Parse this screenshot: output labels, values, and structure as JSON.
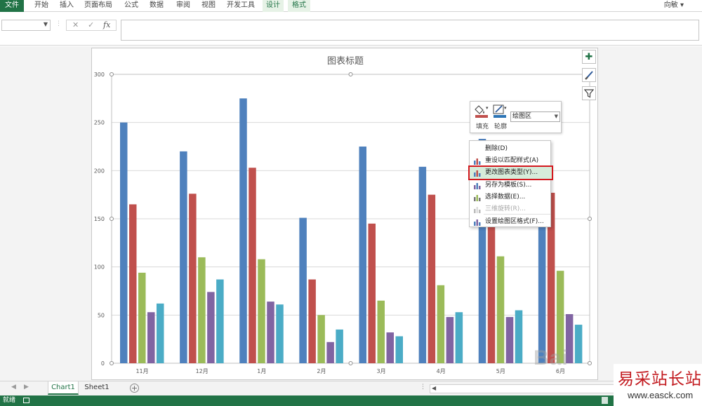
{
  "ribbon": {
    "tabs": [
      {
        "label": "文件",
        "kind": "file"
      },
      {
        "label": "开始",
        "kind": "normal"
      },
      {
        "label": "插入",
        "kind": "normal"
      },
      {
        "label": "页面布局",
        "kind": "normal"
      },
      {
        "label": "公式",
        "kind": "normal"
      },
      {
        "label": "数据",
        "kind": "normal"
      },
      {
        "label": "审阅",
        "kind": "normal"
      },
      {
        "label": "视图",
        "kind": "normal"
      },
      {
        "label": "开发工具",
        "kind": "normal"
      },
      {
        "label": "设计",
        "kind": "context"
      },
      {
        "label": "格式",
        "kind": "context"
      }
    ],
    "user": "向敏 ▾"
  },
  "formula_bar": {
    "name_box": "",
    "cancel_icon": "✕",
    "enter_icon": "✓",
    "fx_label": "fx",
    "formula": ""
  },
  "colors": {
    "excel_green": "#217346",
    "series": [
      "#4f81bd",
      "#c0504d",
      "#9bbb59",
      "#8064a2",
      "#4bacc6"
    ],
    "highlight_box": "#d3181e"
  },
  "chart_data": {
    "type": "bar",
    "title": "图表标题",
    "categories": [
      "11月",
      "12月",
      "1月",
      "2月",
      "3月",
      "4月",
      "5月",
      "6月"
    ],
    "series": [
      {
        "values": [
          250,
          220,
          275,
          151,
          225,
          204,
          233,
          210
        ]
      },
      {
        "values": [
          165,
          176,
          203,
          87,
          145,
          175,
          200,
          177
        ]
      },
      {
        "values": [
          94,
          110,
          108,
          50,
          65,
          81,
          111,
          96
        ]
      },
      {
        "values": [
          53,
          74,
          64,
          22,
          32,
          48,
          48,
          51
        ]
      },
      {
        "values": [
          62,
          87,
          61,
          35,
          28,
          53,
          55,
          40
        ]
      }
    ],
    "yticks": [
      "0",
      "50",
      "100",
      "150",
      "200",
      "250",
      "300"
    ],
    "ylim": [
      0,
      300
    ],
    "grid": true,
    "legend": "none"
  },
  "side_buttons": [
    {
      "name": "chart-elements-button",
      "glyph": "✚"
    },
    {
      "name": "chart-styles-button",
      "glyph": "✎"
    },
    {
      "name": "chart-filters-button",
      "glyph": "▼"
    }
  ],
  "mini_toolbar": {
    "fill_label": "填充",
    "outline_label": "轮廓",
    "element_select": "绘图区"
  },
  "context_menu": [
    {
      "label": "删除(D)",
      "icon": "",
      "disabled": false,
      "highlight": false
    },
    {
      "label": "重设以匹配样式(A)",
      "icon": "reset-style-icon",
      "disabled": false,
      "highlight": false
    },
    {
      "label": "更改图表类型(Y)...",
      "icon": "change-chart-type-icon",
      "disabled": false,
      "highlight": true
    },
    {
      "label": "另存为模板(S)...",
      "icon": "save-template-icon",
      "disabled": false,
      "highlight": false
    },
    {
      "label": "选择数据(E)...",
      "icon": "select-data-icon",
      "disabled": false,
      "highlight": false
    },
    {
      "label": "三维旋转(R)...",
      "icon": "3d-rotation-icon",
      "disabled": true,
      "highlight": false
    },
    {
      "label": "设置绘图区格式(F)...",
      "icon": "format-plot-area-icon",
      "disabled": false,
      "highlight": false
    }
  ],
  "sheet_tabs": [
    {
      "label": "Chart1",
      "active": true
    },
    {
      "label": "Sheet1",
      "active": false
    }
  ],
  "add_sheet_glyph": "+",
  "status": {
    "text": "就绪"
  },
  "watermarks": {
    "baidu": "Bai",
    "site_cn": "易采站长站",
    "site_url": "www.easck.com"
  }
}
